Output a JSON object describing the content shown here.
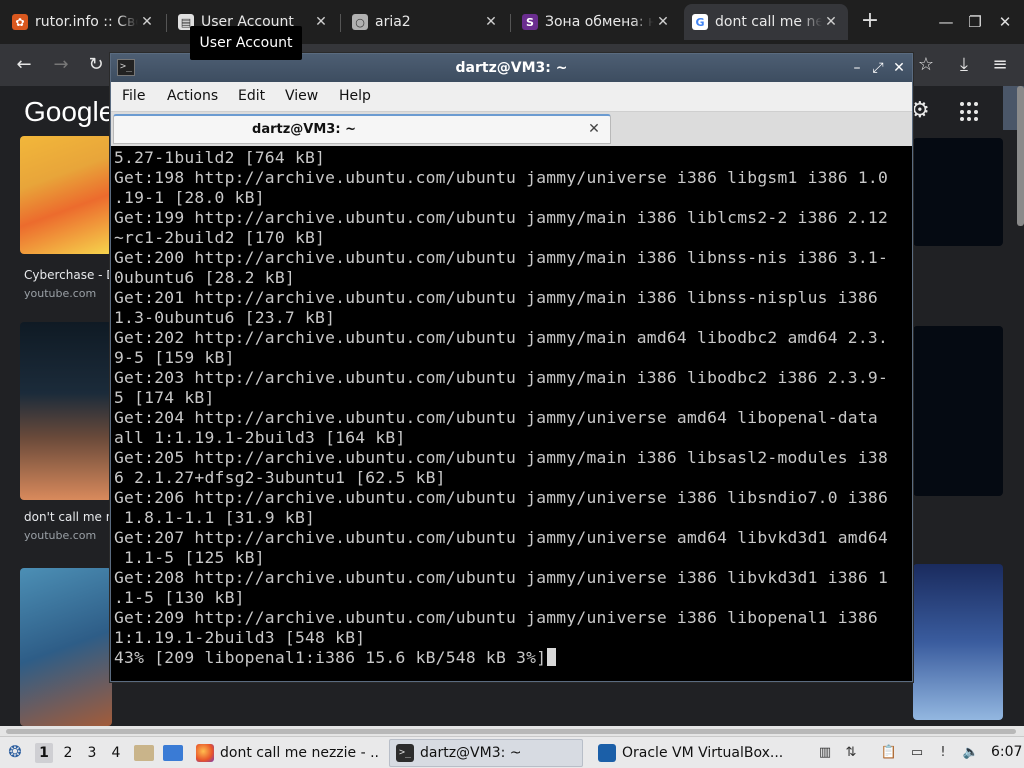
{
  "browser": {
    "tabs": [
      {
        "title": "rutor.info :: Своб",
        "favicon": "rutor-icon",
        "color": "#d9581f",
        "active": false
      },
      {
        "title": "User Account",
        "favicon": "document-icon",
        "color": "#e0e0e0",
        "active": false
      },
      {
        "title": "aria2",
        "favicon": "aria2-icon",
        "color": "#b0b0b0",
        "active": false
      },
      {
        "title": "Зона обмена: на",
        "favicon": "s-icon",
        "color": "#6a2d8f",
        "active": false
      },
      {
        "title": "dont call me nez",
        "favicon": "google-icon",
        "color": "#ffffff",
        "active": true
      }
    ],
    "tooltip": "User Account"
  },
  "page": {
    "logo": "Google",
    "results": [
      {
        "title": "Cyberchase - DC",
        "source": "youtube.com"
      },
      {
        "title": "don't call me ne",
        "source": "youtube.com"
      }
    ]
  },
  "terminal": {
    "window_title": "dartz@VM3: ~",
    "menu": [
      "File",
      "Actions",
      "Edit",
      "View",
      "Help"
    ],
    "tab_label": "dartz@VM3: ~",
    "lines": [
      "5.27-1build2 [764 kB]",
      "Get:198 http://archive.ubuntu.com/ubuntu jammy/universe i386 libgsm1 i386 1.0",
      ".19-1 [28.0 kB]",
      "Get:199 http://archive.ubuntu.com/ubuntu jammy/main i386 liblcms2-2 i386 2.12",
      "~rc1-2build2 [170 kB]",
      "Get:200 http://archive.ubuntu.com/ubuntu jammy/main i386 libnss-nis i386 3.1-",
      "0ubuntu6 [28.2 kB]",
      "Get:201 http://archive.ubuntu.com/ubuntu jammy/main i386 libnss-nisplus i386",
      "1.3-0ubuntu6 [23.7 kB]",
      "Get:202 http://archive.ubuntu.com/ubuntu jammy/main amd64 libodbc2 amd64 2.3.",
      "9-5 [159 kB]",
      "Get:203 http://archive.ubuntu.com/ubuntu jammy/main i386 libodbc2 i386 2.3.9-",
      "5 [174 kB]",
      "Get:204 http://archive.ubuntu.com/ubuntu jammy/universe amd64 libopenal-data",
      "all 1:1.19.1-2build3 [164 kB]",
      "Get:205 http://archive.ubuntu.com/ubuntu jammy/main i386 libsasl2-modules i38",
      "6 2.1.27+dfsg2-3ubuntu1 [62.5 kB]",
      "Get:206 http://archive.ubuntu.com/ubuntu jammy/universe i386 libsndio7.0 i386",
      " 1.8.1-1.1 [31.9 kB]",
      "Get:207 http://archive.ubuntu.com/ubuntu jammy/universe amd64 libvkd3d1 amd64",
      " 1.1-5 [125 kB]",
      "Get:208 http://archive.ubuntu.com/ubuntu jammy/universe i386 libvkd3d1 i386 1",
      ".1-5 [130 kB]",
      "Get:209 http://archive.ubuntu.com/ubuntu jammy/universe i386 libopenal1 i386",
      "1:1.19.1-2build3 [548 kB]"
    ],
    "progress_line": "43% [209 libopenal1:i386 15.6 kB/548 kB 3%]"
  },
  "taskbar": {
    "workspaces": [
      "1",
      "2",
      "3",
      "4"
    ],
    "tasks": [
      {
        "label": "dont call me nezzie - ...",
        "icon": "firefox-icon"
      },
      {
        "label": "dartz@VM3: ~",
        "icon": "terminal-icon"
      },
      {
        "label": "Oracle VM VirtualBox...",
        "icon": "virtualbox-icon"
      }
    ],
    "clock": "6:07"
  }
}
